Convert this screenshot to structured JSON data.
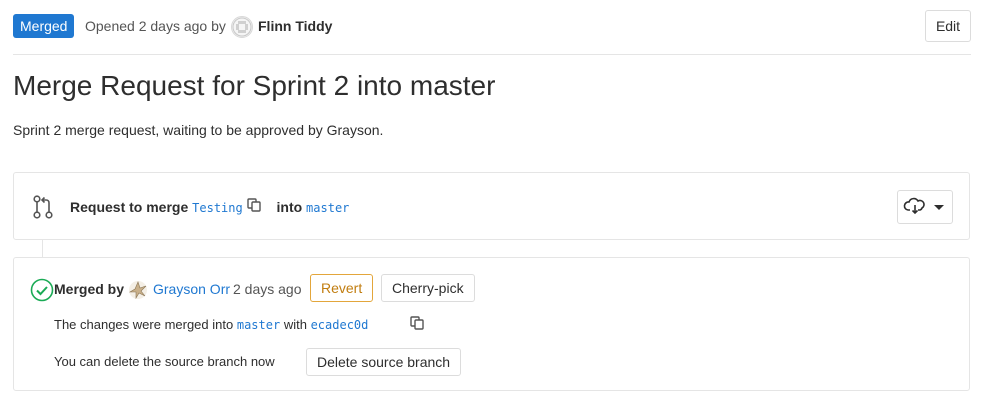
{
  "header": {
    "status_badge": "Merged",
    "opened_text": "Opened 2 days ago by",
    "author": "Flinn Tiddy",
    "edit_label": "Edit"
  },
  "title": "Merge Request for Sprint 2 into master",
  "description": "Sprint 2 merge request, waiting to be approved by Grayson.",
  "request": {
    "prefix": "Request to merge",
    "source_branch": "Testing",
    "into": "into",
    "target_branch": "master"
  },
  "merged": {
    "merged_by_label": "Merged by",
    "merger_name": "Grayson Orr",
    "merged_time": "2 days ago",
    "revert_label": "Revert",
    "cherry_pick_label": "Cherry-pick",
    "changes_prefix": "The changes were merged into",
    "changes_branch": "master",
    "changes_with": "with",
    "commit": "ecadec0d",
    "delete_text": "You can delete the source branch now",
    "delete_button": "Delete source branch"
  },
  "colors": {
    "accent": "#1f78d1",
    "success": "#1aaa55",
    "warning": "#e3a63b"
  },
  "icons": [
    "avatar",
    "merge-request-icon",
    "copy-icon",
    "cloud-download-icon",
    "chevron-down-icon",
    "check-circle-icon"
  ]
}
